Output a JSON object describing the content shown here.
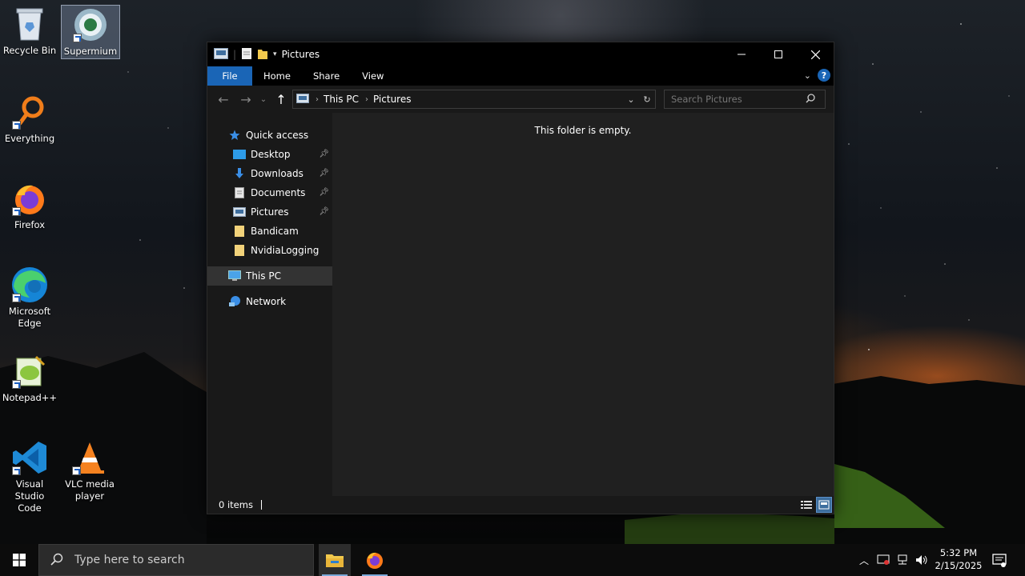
{
  "desktop": {
    "icons": [
      {
        "label": "Recycle Bin"
      },
      {
        "label": "Supermium"
      },
      {
        "label": "Everything"
      },
      {
        "label": "Firefox"
      },
      {
        "label": "Microsoft\nEdge"
      },
      {
        "label": "Notepad++"
      },
      {
        "label": "Visual Studio\nCode"
      },
      {
        "label": "VLC media\nplayer"
      }
    ]
  },
  "window": {
    "title": "Pictures",
    "ribbon_tabs": [
      "File",
      "Home",
      "Share",
      "View"
    ],
    "help_label": "?",
    "address": {
      "crumbs": [
        "This PC",
        "Pictures"
      ]
    },
    "search": {
      "placeholder": "Search Pictures"
    },
    "sidebar": {
      "quick_access": "Quick access",
      "items": [
        "Desktop",
        "Downloads",
        "Documents",
        "Pictures",
        "Bandicam",
        "NvidiaLogging"
      ],
      "this_pc": "This PC",
      "network": "Network"
    },
    "content": {
      "empty_message": "This folder is empty."
    },
    "status": {
      "item_count": "0 items"
    }
  },
  "taskbar": {
    "search_placeholder": "Type here to search",
    "time": "5:32 PM",
    "date": "2/15/2025"
  },
  "colors": {
    "accent": "#1a65b6",
    "folder": "#f2c94c"
  }
}
